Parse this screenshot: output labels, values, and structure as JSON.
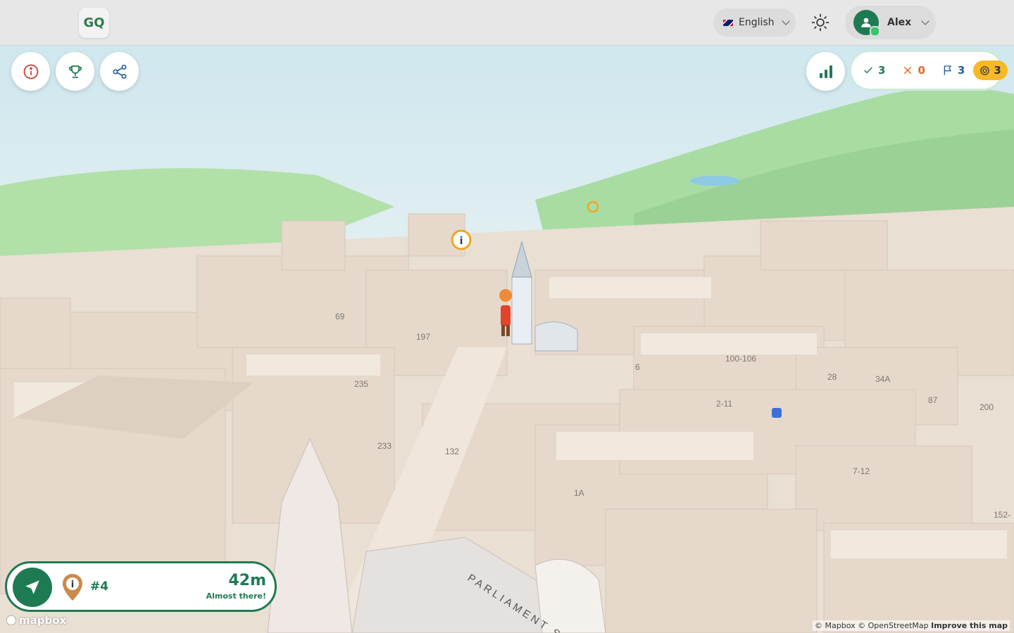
{
  "header": {
    "logo_text": "GQ",
    "language": "English",
    "user_name": "Alex"
  },
  "toolbar": {
    "info_icon": "info-icon",
    "trophy_icon": "trophy-icon",
    "share_icon": "share-icon",
    "stats_icon": "bar-chart-icon"
  },
  "stats": {
    "correct": "3",
    "wrong": "0",
    "flags": "3",
    "coins": "3",
    "colors": {
      "correct": "#1e7a52",
      "wrong": "#e0692a",
      "flags": "#1e5fa0",
      "coin_bg": "#f7b928"
    }
  },
  "map": {
    "labels": [
      "69",
      "197",
      "235",
      "233",
      "132",
      "1A",
      "6",
      "100-106",
      "2-11",
      "28",
      "34A",
      "87",
      "200",
      "7-12",
      "152-"
    ],
    "street": "PARLIAMENT SQ"
  },
  "navigation": {
    "target": "#4",
    "distance": "42m",
    "status": "Almost there!"
  },
  "attribution": {
    "mapbox": "mapbox",
    "text": "© Mapbox © OpenStreetMap",
    "improve": "Improve this map"
  },
  "colors": {
    "primary": "#1e7a52",
    "accent": "#f7b928"
  }
}
